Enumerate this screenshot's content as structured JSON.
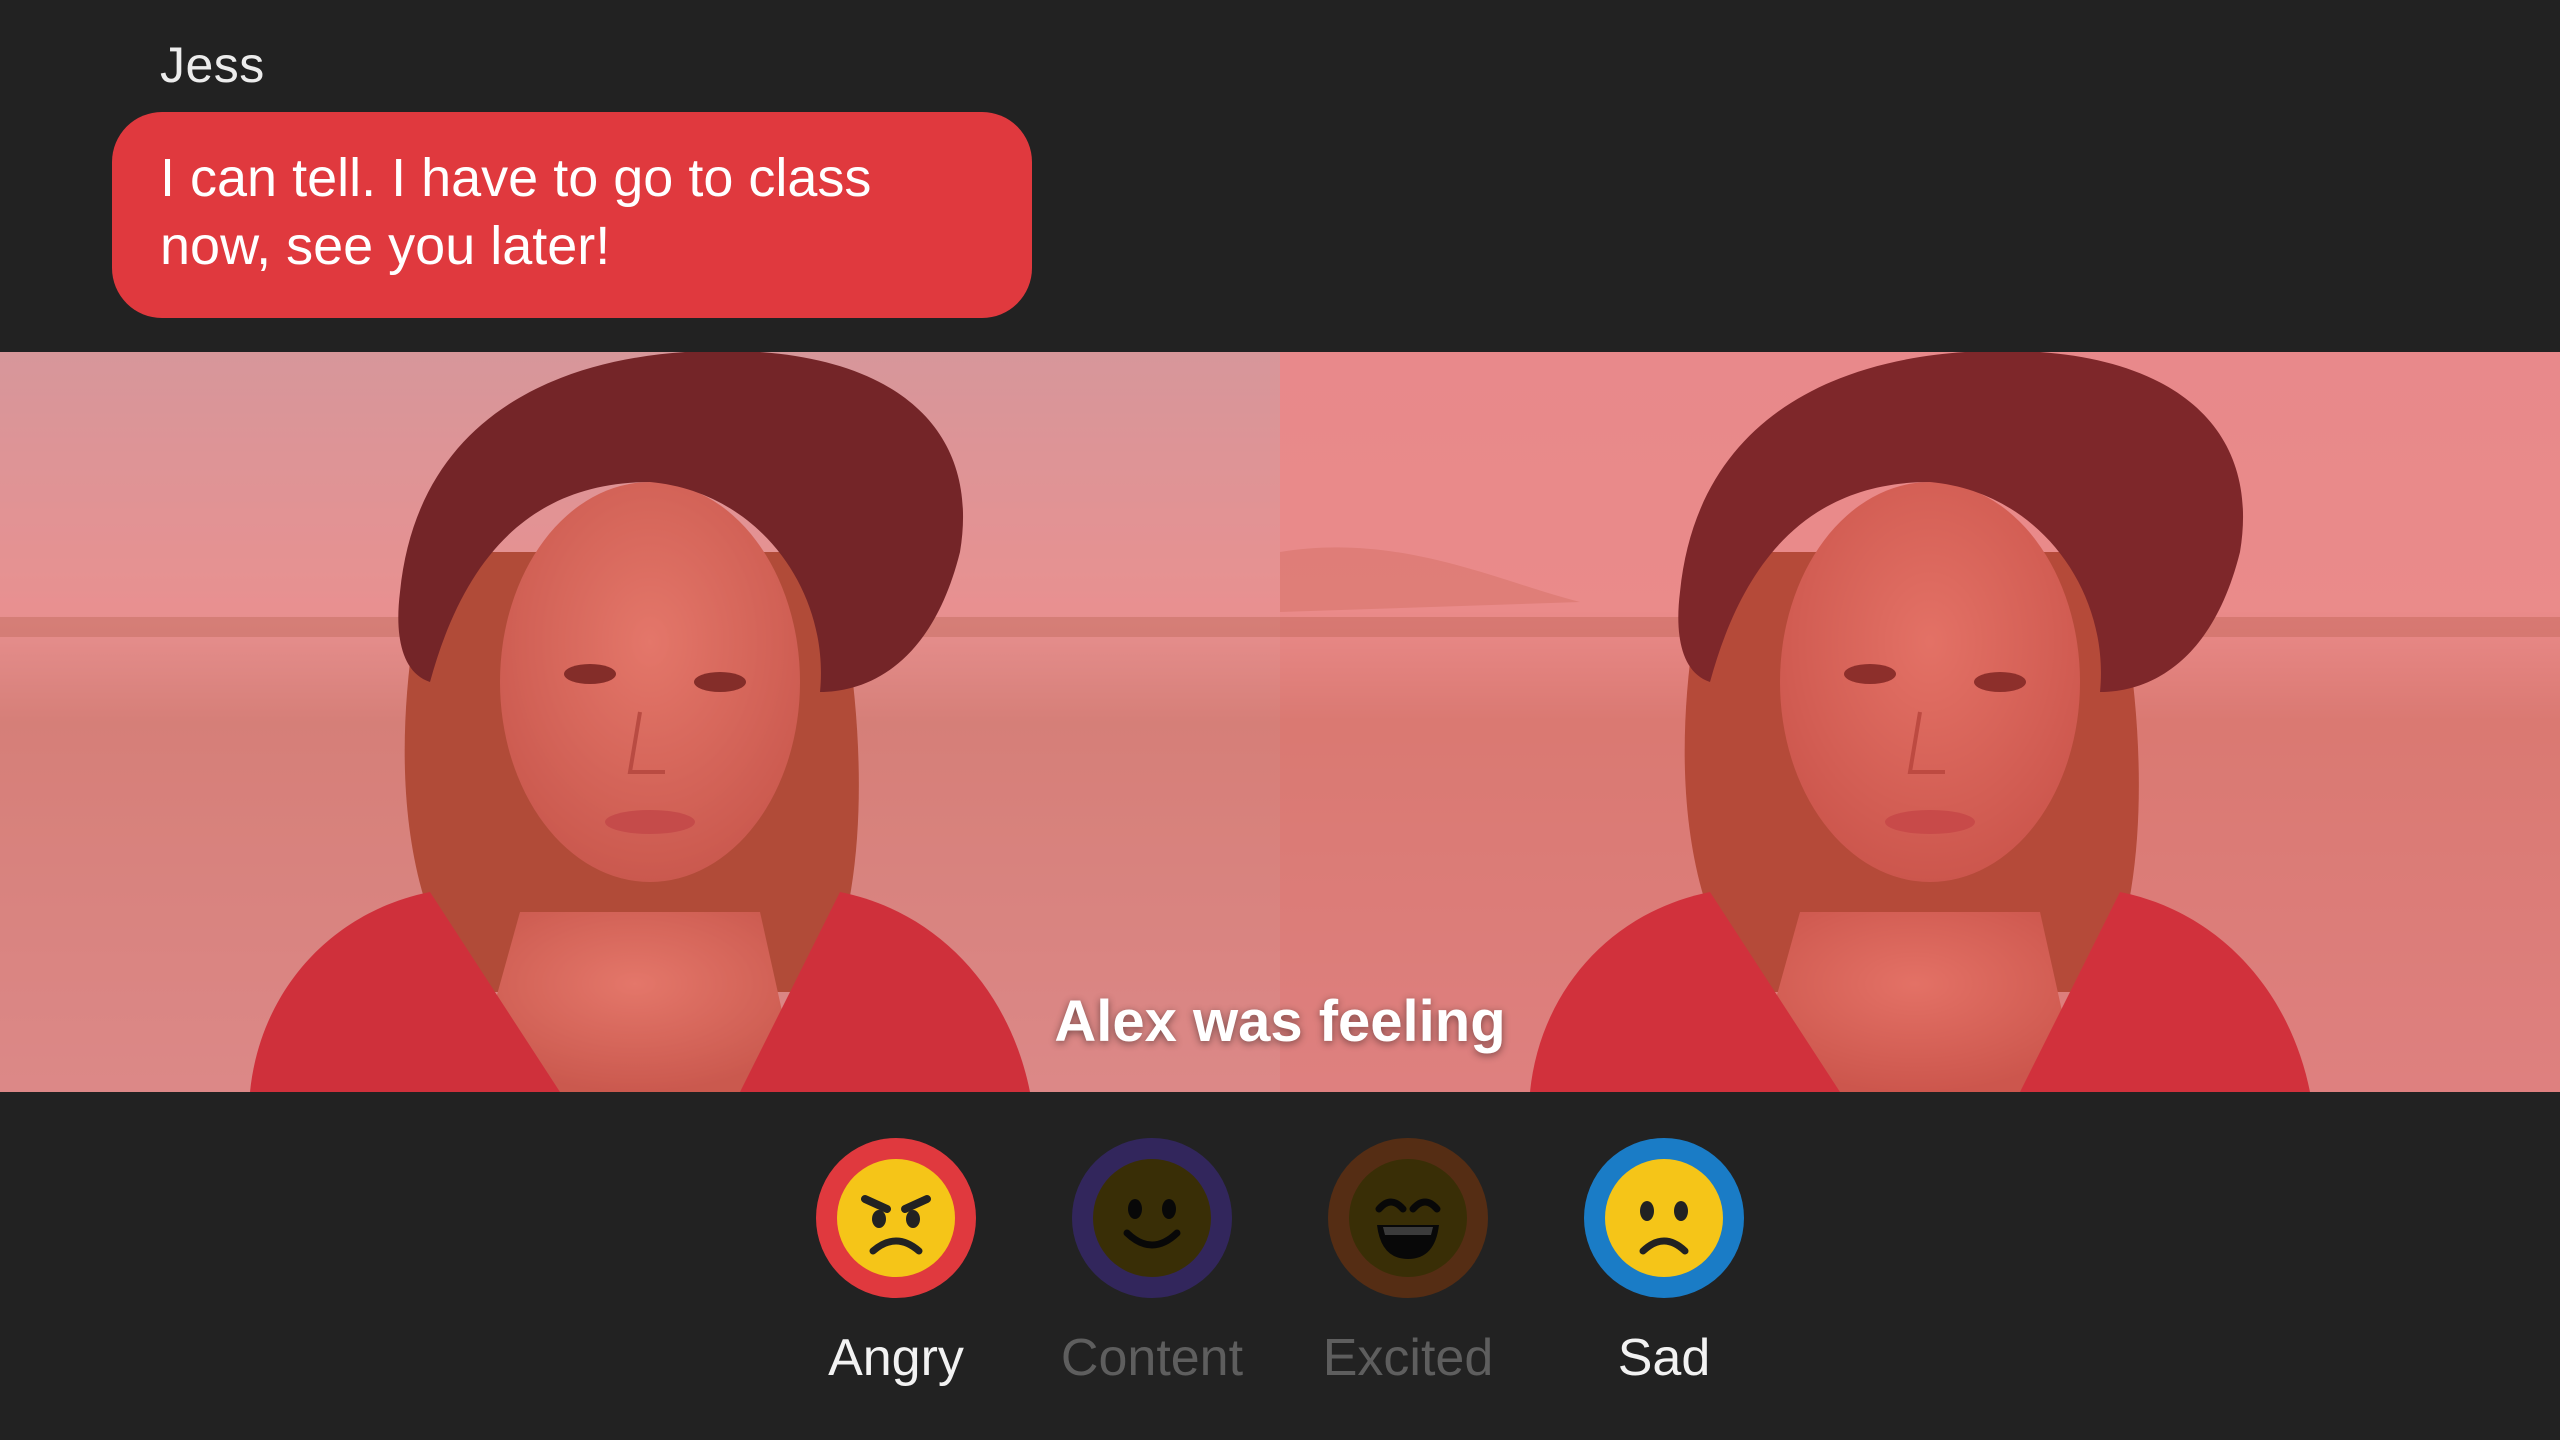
{
  "chat": {
    "sender": "Jess",
    "message": "I can tell. I have to go to class now, see you later!",
    "bubble_color": "#e0393e"
  },
  "prompt": {
    "caption": "Alex was feeling"
  },
  "images": {
    "tint_color": "#e0393e",
    "subject": "woman in black hat and red floral top by the water"
  },
  "options": [
    {
      "label": "Angry",
      "ring_color": "#e0393e",
      "icon": "angry-face-icon",
      "state": "active"
    },
    {
      "label": "Content",
      "ring_color": "#4a3a88",
      "icon": "smiling-face-icon",
      "state": "dim"
    },
    {
      "label": "Excited",
      "ring_color": "#8a4a1e",
      "icon": "grinning-face-icon",
      "state": "dim"
    },
    {
      "label": "Sad",
      "ring_color": "#1a7cc6",
      "icon": "frowning-face-icon",
      "state": "active"
    }
  ]
}
